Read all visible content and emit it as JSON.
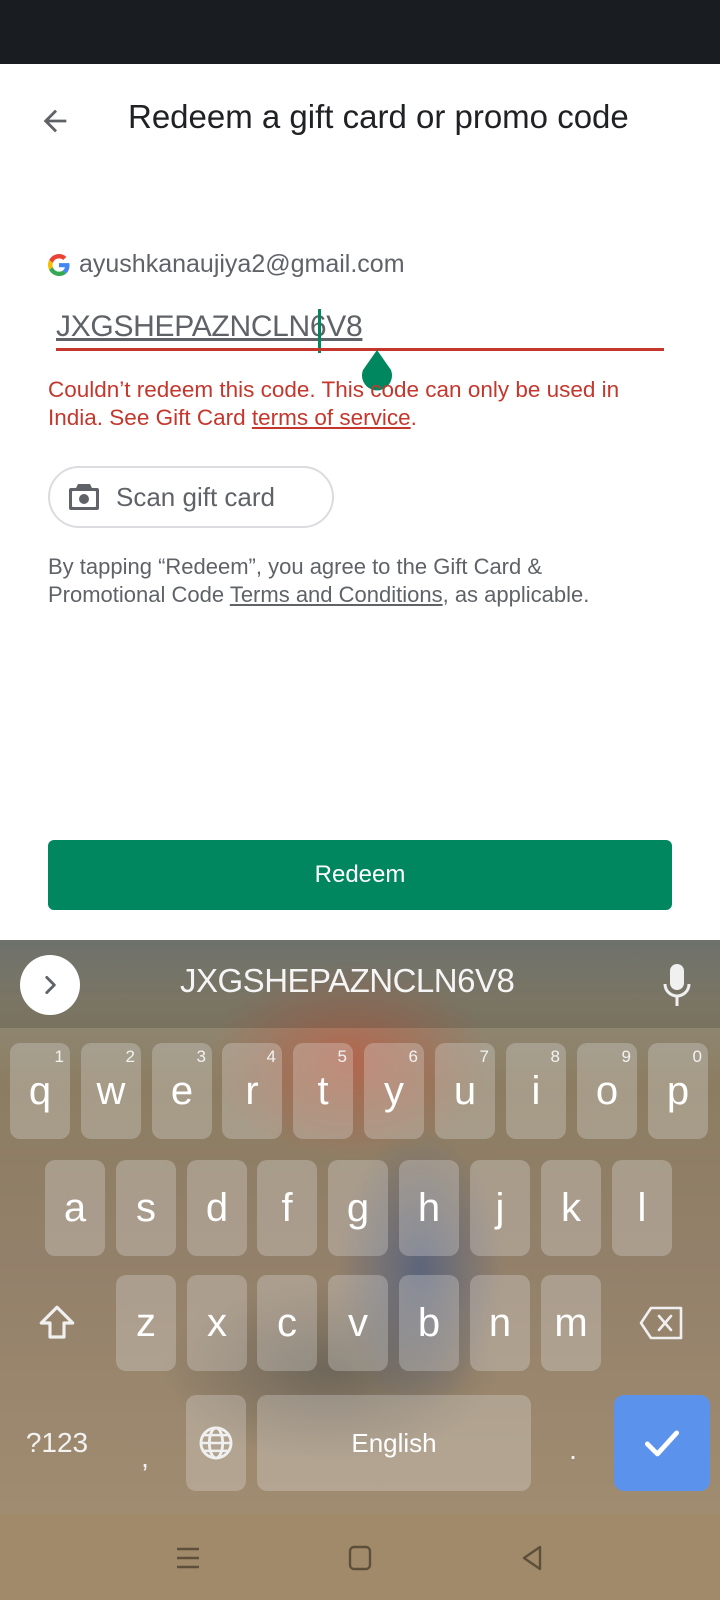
{
  "header": {
    "title": "Redeem a gift card or promo code",
    "back_icon": "arrow-left-icon"
  },
  "account": {
    "provider_icon": "google-g-icon",
    "email": "ayushkanaujiya2@gmail.com"
  },
  "code_field": {
    "value": "JXGSHEPAZNCLN6V8",
    "state": "error"
  },
  "error": {
    "text_before_link": "Couldn’t redeem this code. This code can only be used in India. See Gift Card ",
    "link": "terms of service",
    "text_after_link": "."
  },
  "scan_button": {
    "icon": "camera-icon",
    "label": "Scan gift card"
  },
  "terms": {
    "text_before_link": "By tapping “Redeem”, you agree to the Gift Card & Promotional Code ",
    "link": "Terms and Conditions",
    "text_after_link": ", as applicable."
  },
  "redeem_button": {
    "label": "Redeem"
  },
  "keyboard": {
    "suggestion": "JXGSHEPAZNCLN6V8",
    "row1": [
      {
        "key": "q",
        "hint": "1"
      },
      {
        "key": "w",
        "hint": "2"
      },
      {
        "key": "e",
        "hint": "3"
      },
      {
        "key": "r",
        "hint": "4"
      },
      {
        "key": "t",
        "hint": "5"
      },
      {
        "key": "y",
        "hint": "6"
      },
      {
        "key": "u",
        "hint": "7"
      },
      {
        "key": "i",
        "hint": "8"
      },
      {
        "key": "o",
        "hint": "9"
      },
      {
        "key": "p",
        "hint": "0"
      }
    ],
    "row2": [
      "a",
      "s",
      "d",
      "f",
      "g",
      "h",
      "j",
      "k",
      "l"
    ],
    "row3": [
      "z",
      "x",
      "c",
      "v",
      "b",
      "n",
      "m"
    ],
    "symbols_label": "?123",
    "comma": ",",
    "space_label": "English",
    "period": "."
  },
  "colors": {
    "accent": "#01875f",
    "error": "#c5372c",
    "status_bar": "#191d21",
    "enter_key": "#5b93ec"
  }
}
